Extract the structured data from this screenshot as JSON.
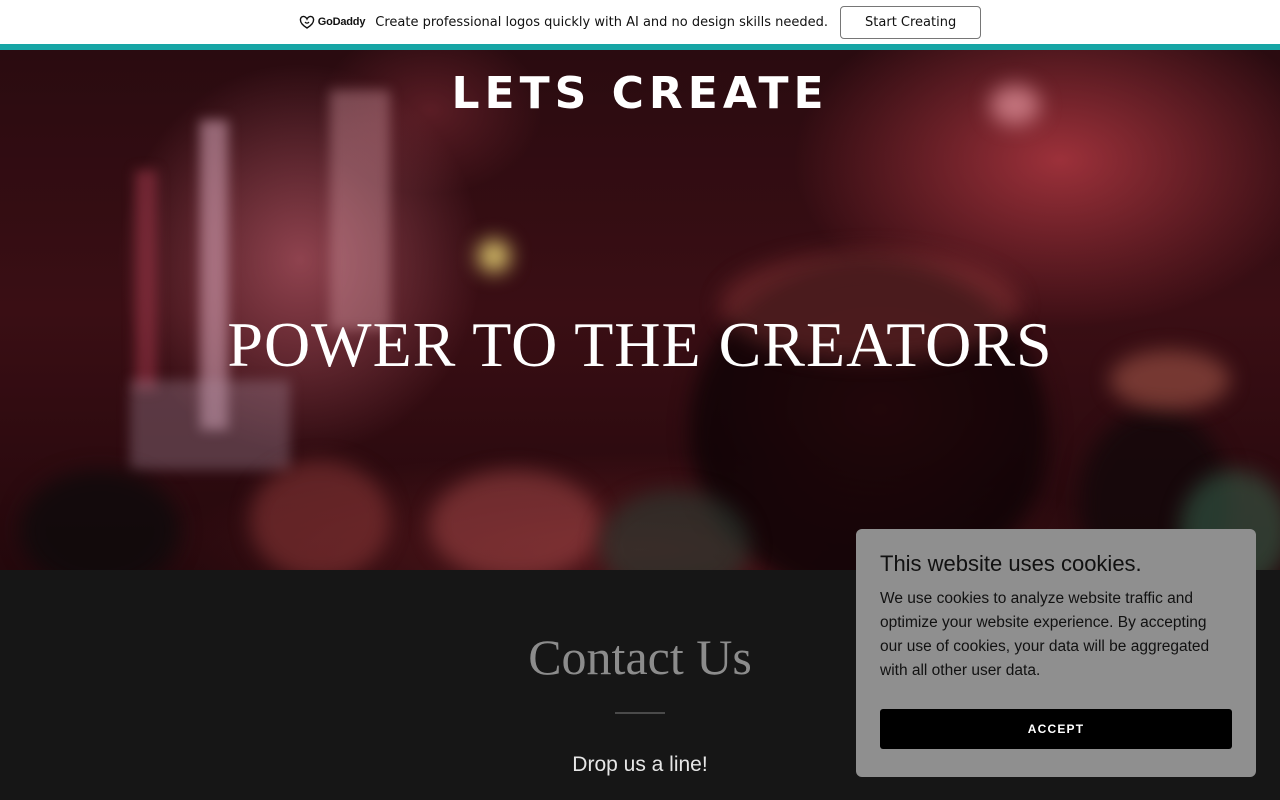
{
  "promo": {
    "logo_text": "GoDaddy",
    "message": "Create professional logos quickly with AI and no design skills needed.",
    "button_label": "Start Creating"
  },
  "hero": {
    "site_title": "LETS CREATE",
    "tagline": "POWER TO THE CREATORS"
  },
  "contact": {
    "heading": "Contact Us",
    "subheading": "Drop us a line!"
  },
  "cookie_banner": {
    "title": "This website uses cookies.",
    "body": "We use cookies to analyze website traffic and optimize your website experience. By accepting our use of cookies, your data will be aggregated with all other user data.",
    "accept_label": "ACCEPT"
  },
  "colors": {
    "accent_stripe": "#16a5a5",
    "contact_background": "#161616",
    "cookie_background": "#8f8f8f",
    "accept_button": "#000000"
  }
}
